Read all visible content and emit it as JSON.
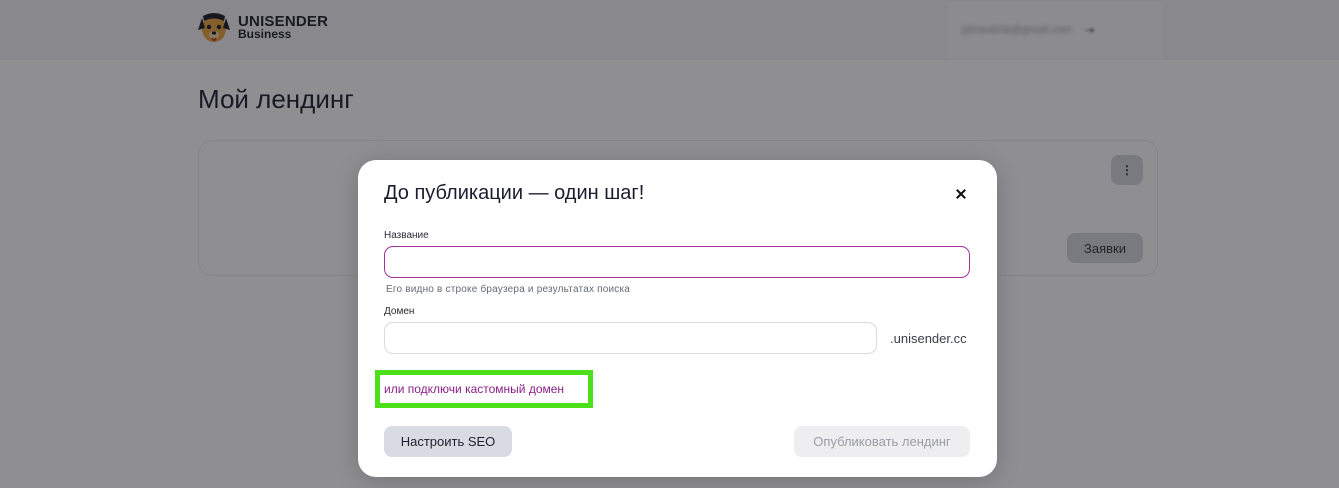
{
  "app": {
    "logo_title": "UNISENDER",
    "logo_subtitle": "Business",
    "user_email": "jdmsuilmk@gmail.com"
  },
  "page": {
    "title": "Мой лендинг",
    "card_button": "Заявки",
    "card_menu_icon": "⋮"
  },
  "modal": {
    "title": "До публикации — один шаг!",
    "name_label": "Название",
    "name_value": "",
    "name_hint": "Его видно в строке браузера и результатах поиска",
    "domain_label": "Домен",
    "domain_value": "",
    "domain_suffix": ".unisender.cc",
    "custom_domain_link": "или подключи кастомный домен",
    "seo_button": "Настроить SEO",
    "publish_button": "Опубликовать лендинг"
  },
  "colors": {
    "accent": "#a7309f",
    "link": "#8a1f87",
    "highlight": "#4ce01a"
  },
  "icons": [
    "logo-dog-icon",
    "chevron-icon",
    "more-vertical-icon",
    "close-icon"
  ]
}
